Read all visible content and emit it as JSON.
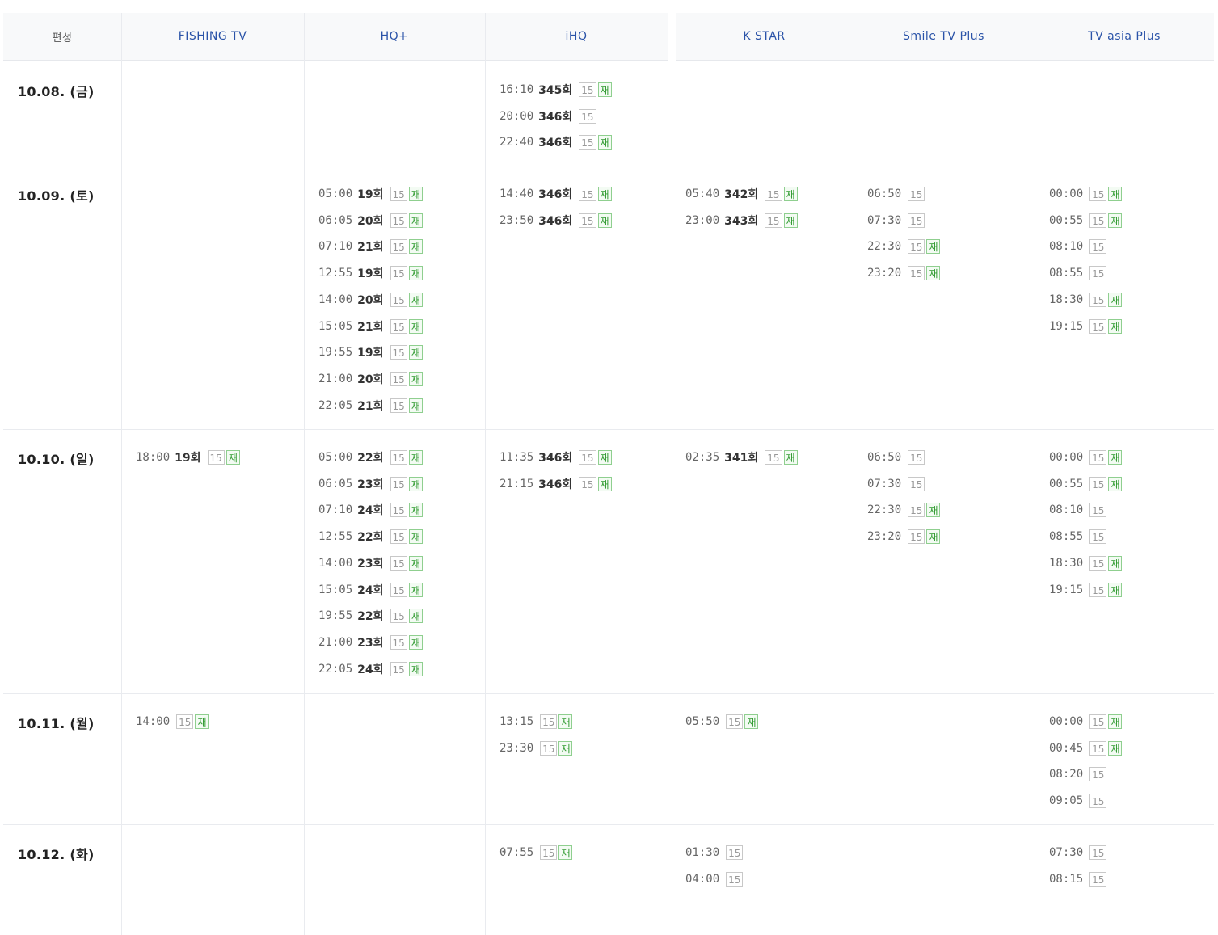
{
  "header": {
    "corner": "편성",
    "channels": [
      "FISHING TV",
      "HQ+",
      "iHQ",
      "K STAR",
      "Smile TV Plus",
      "TV asia Plus"
    ]
  },
  "badges": {
    "rating": "15",
    "rerun": "재"
  },
  "rows": [
    {
      "date": "10.08. (금)",
      "cells": [
        [],
        [],
        [
          {
            "time": "16:10",
            "ep": "345회",
            "rerun": true
          },
          {
            "time": "20:00",
            "ep": "346회",
            "rerun": false
          },
          {
            "time": "22:40",
            "ep": "346회",
            "rerun": true
          }
        ],
        [],
        [],
        []
      ]
    },
    {
      "date": "10.09. (토)",
      "cells": [
        [],
        [
          {
            "time": "05:00",
            "ep": "19회",
            "rerun": true
          },
          {
            "time": "06:05",
            "ep": "20회",
            "rerun": true
          },
          {
            "time": "07:10",
            "ep": "21회",
            "rerun": true
          },
          {
            "time": "12:55",
            "ep": "19회",
            "rerun": true
          },
          {
            "time": "14:00",
            "ep": "20회",
            "rerun": true
          },
          {
            "time": "15:05",
            "ep": "21회",
            "rerun": true
          },
          {
            "time": "19:55",
            "ep": "19회",
            "rerun": true
          },
          {
            "time": "21:00",
            "ep": "20회",
            "rerun": true
          },
          {
            "time": "22:05",
            "ep": "21회",
            "rerun": true
          }
        ],
        [
          {
            "time": "14:40",
            "ep": "346회",
            "rerun": true
          },
          {
            "time": "23:50",
            "ep": "346회",
            "rerun": true
          }
        ],
        [
          {
            "time": "05:40",
            "ep": "342회",
            "rerun": true
          },
          {
            "time": "23:00",
            "ep": "343회",
            "rerun": true
          }
        ],
        [
          {
            "time": "06:50",
            "ep": "",
            "rerun": false
          },
          {
            "time": "07:30",
            "ep": "",
            "rerun": false
          },
          {
            "time": "22:30",
            "ep": "",
            "rerun": true
          },
          {
            "time": "23:20",
            "ep": "",
            "rerun": true
          }
        ],
        [
          {
            "time": "00:00",
            "ep": "",
            "rerun": true
          },
          {
            "time": "00:55",
            "ep": "",
            "rerun": true
          },
          {
            "time": "08:10",
            "ep": "",
            "rerun": false
          },
          {
            "time": "08:55",
            "ep": "",
            "rerun": false
          },
          {
            "time": "18:30",
            "ep": "",
            "rerun": true
          },
          {
            "time": "19:15",
            "ep": "",
            "rerun": true
          }
        ]
      ]
    },
    {
      "date": "10.10. (일)",
      "cells": [
        [
          {
            "time": "18:00",
            "ep": "19회",
            "rerun": true
          }
        ],
        [
          {
            "time": "05:00",
            "ep": "22회",
            "rerun": true
          },
          {
            "time": "06:05",
            "ep": "23회",
            "rerun": true
          },
          {
            "time": "07:10",
            "ep": "24회",
            "rerun": true
          },
          {
            "time": "12:55",
            "ep": "22회",
            "rerun": true
          },
          {
            "time": "14:00",
            "ep": "23회",
            "rerun": true
          },
          {
            "time": "15:05",
            "ep": "24회",
            "rerun": true
          },
          {
            "time": "19:55",
            "ep": "22회",
            "rerun": true
          },
          {
            "time": "21:00",
            "ep": "23회",
            "rerun": true
          },
          {
            "time": "22:05",
            "ep": "24회",
            "rerun": true
          }
        ],
        [
          {
            "time": "11:35",
            "ep": "346회",
            "rerun": true
          },
          {
            "time": "21:15",
            "ep": "346회",
            "rerun": true
          }
        ],
        [
          {
            "time": "02:35",
            "ep": "341회",
            "rerun": true
          }
        ],
        [
          {
            "time": "06:50",
            "ep": "",
            "rerun": false
          },
          {
            "time": "07:30",
            "ep": "",
            "rerun": false
          },
          {
            "time": "22:30",
            "ep": "",
            "rerun": true
          },
          {
            "time": "23:20",
            "ep": "",
            "rerun": true
          }
        ],
        [
          {
            "time": "00:00",
            "ep": "",
            "rerun": true
          },
          {
            "time": "00:55",
            "ep": "",
            "rerun": true
          },
          {
            "time": "08:10",
            "ep": "",
            "rerun": false
          },
          {
            "time": "08:55",
            "ep": "",
            "rerun": false
          },
          {
            "time": "18:30",
            "ep": "",
            "rerun": true
          },
          {
            "time": "19:15",
            "ep": "",
            "rerun": true
          }
        ]
      ]
    },
    {
      "date": "10.11. (월)",
      "cells": [
        [
          {
            "time": "14:00",
            "ep": "",
            "rerun": true
          }
        ],
        [],
        [
          {
            "time": "13:15",
            "ep": "",
            "rerun": true
          },
          {
            "time": "23:30",
            "ep": "",
            "rerun": true
          }
        ],
        [
          {
            "time": "05:50",
            "ep": "",
            "rerun": true
          }
        ],
        [],
        [
          {
            "time": "00:00",
            "ep": "",
            "rerun": true
          },
          {
            "time": "00:45",
            "ep": "",
            "rerun": true
          },
          {
            "time": "08:20",
            "ep": "",
            "rerun": false
          },
          {
            "time": "09:05",
            "ep": "",
            "rerun": false
          }
        ]
      ]
    },
    {
      "date": "10.12. (화)",
      "cells": [
        [],
        [],
        [
          {
            "time": "07:55",
            "ep": "",
            "rerun": true
          }
        ],
        [
          {
            "time": "01:30",
            "ep": "",
            "rerun": false
          },
          {
            "time": "04:00",
            "ep": "",
            "rerun": false
          }
        ],
        [],
        [
          {
            "time": "07:30",
            "ep": "",
            "rerun": false
          },
          {
            "time": "08:15",
            "ep": "",
            "rerun": false
          }
        ]
      ]
    }
  ]
}
